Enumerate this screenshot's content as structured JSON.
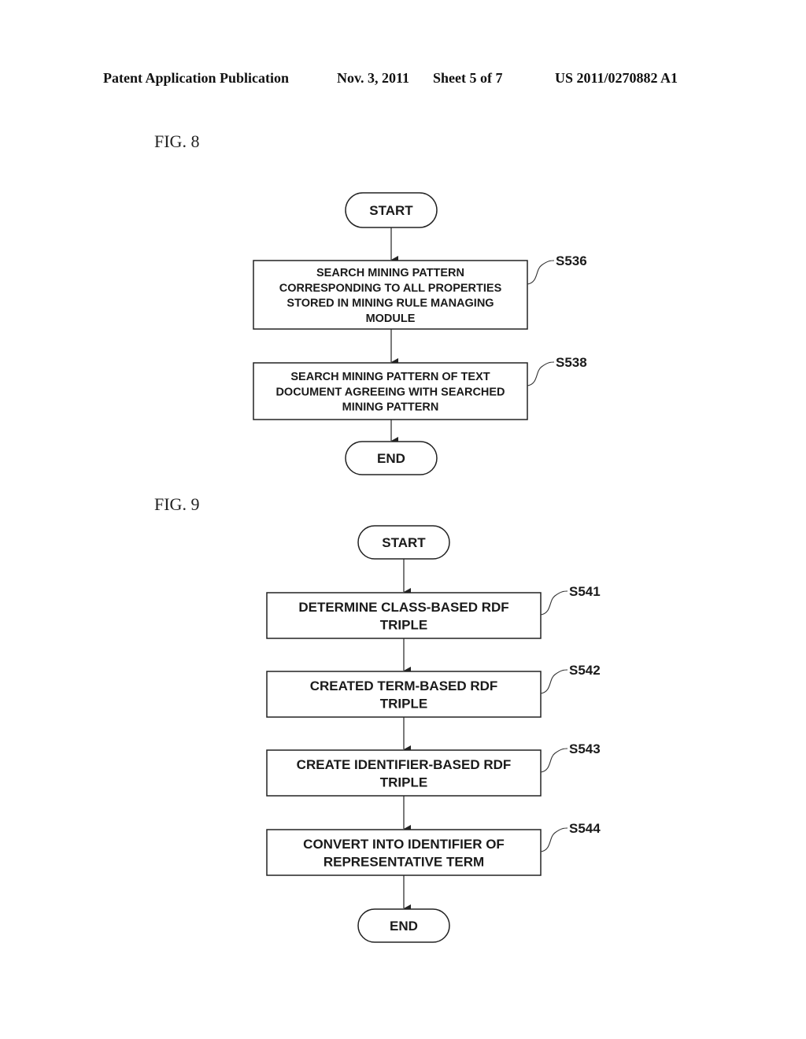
{
  "header": {
    "publication": "Patent Application Publication",
    "date": "Nov. 3, 2011",
    "sheet": "Sheet 5 of 7",
    "number": "US 2011/0270882 A1"
  },
  "figures": [
    {
      "label": "FIG. 8",
      "start": "START",
      "end": "END",
      "steps": [
        {
          "id": "S536",
          "lines": [
            "SEARCH MINING PATTERN",
            "CORRESPONDING TO ALL PROPERTIES",
            "STORED IN MINING RULE MANAGING",
            "MODULE"
          ]
        },
        {
          "id": "S538",
          "lines": [
            "SEARCH MINING PATTERN OF TEXT",
            "DOCUMENT AGREEING WITH SEARCHED",
            "MINING PATTERN"
          ]
        }
      ]
    },
    {
      "label": "FIG. 9",
      "start": "START",
      "end": "END",
      "steps": [
        {
          "id": "S541",
          "lines": [
            "DETERMINE CLASS-BASED RDF",
            "TRIPLE"
          ]
        },
        {
          "id": "S542",
          "lines": [
            "CREATED TERM-BASED RDF",
            "TRIPLE"
          ]
        },
        {
          "id": "S543",
          "lines": [
            "CREATE IDENTIFIER-BASED RDF",
            "TRIPLE"
          ]
        },
        {
          "id": "S544",
          "lines": [
            "CONVERT INTO IDENTIFIER OF",
            "REPRESENTATIVE TERM"
          ]
        }
      ]
    }
  ]
}
